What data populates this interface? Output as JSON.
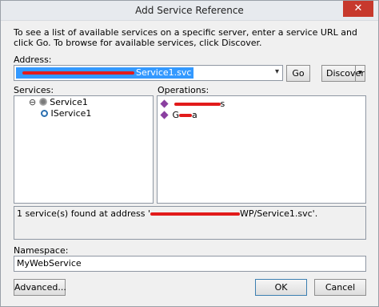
{
  "window": {
    "title": "Add Service Reference",
    "close_glyph": "✕"
  },
  "description": "To see a list of available services on a specific server, enter a service URL and click Go. To browse for available services, click Discover.",
  "address": {
    "label": "Address:",
    "value_visible": "Service1.svc",
    "go_label": "Go",
    "discover_label": "Discover",
    "dropdown_glyph": "▾"
  },
  "services": {
    "label": "Services:",
    "items": [
      {
        "label": "Service1",
        "icon": "service-icon",
        "expander": "⊖"
      },
      {
        "label": "IService1",
        "icon": "contract-icon"
      }
    ]
  },
  "operations": {
    "label": "Operations:",
    "items": [
      {
        "label_visible": "s",
        "icon": "operation-icon"
      },
      {
        "label_visible": "G",
        "label_tail": "a",
        "icon": "operation-icon"
      }
    ]
  },
  "status": {
    "prefix": "1 service(s) found at address '",
    "suffix": "WP/Service1.svc'."
  },
  "namespace": {
    "label": "Namespace:",
    "value": "MyWebService"
  },
  "buttons": {
    "advanced": "Advanced...",
    "ok": "OK",
    "cancel": "Cancel"
  },
  "colors": {
    "selection": "#3399ff",
    "redaction": "#e21b1b",
    "close": "#c7392d"
  }
}
